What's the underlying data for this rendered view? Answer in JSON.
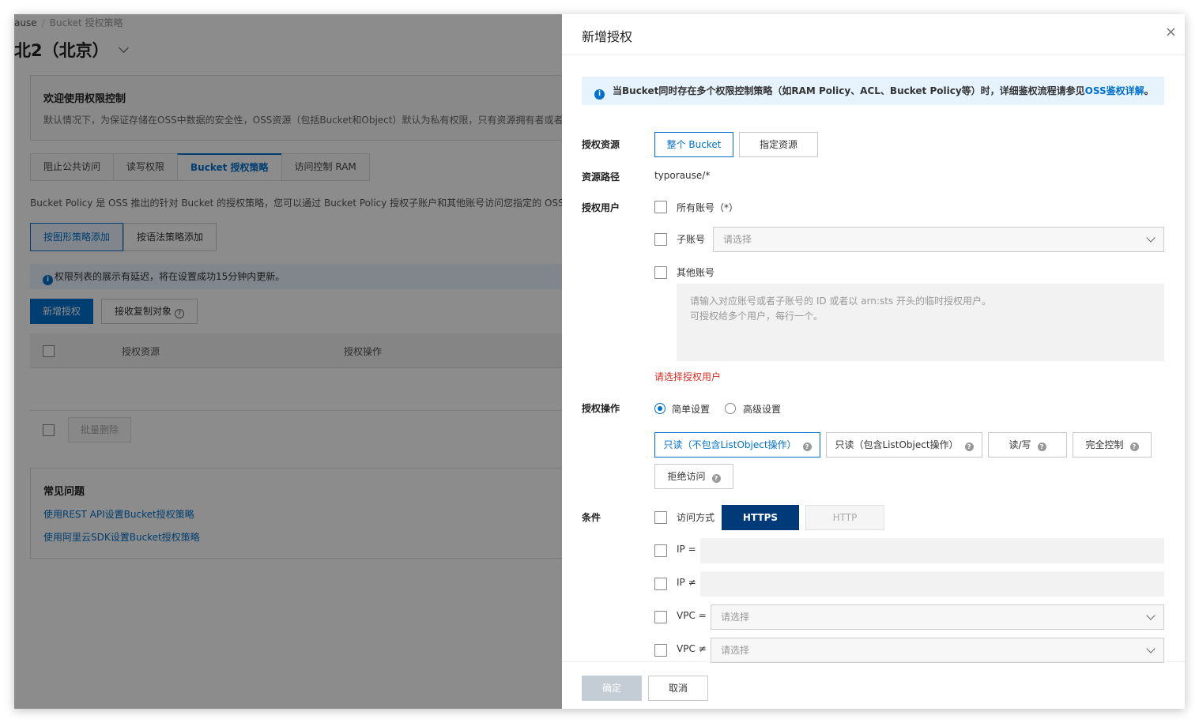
{
  "background": {
    "breadcrumb": {
      "first": "ause",
      "sep": "/",
      "current": "Bucket 授权策略"
    },
    "title": "北2（北京）",
    "welcome": {
      "heading": "欢迎使用权限控制",
      "text": "默认情况下，为保证存储在OSS中数据的安全性，OSS资源（包括Bucket和Object）默认为私有权限，只有资源拥有者或者被"
    },
    "tabs": [
      "阻止公共访问",
      "读写权限",
      "Bucket 授权策略",
      "访问控制 RAM"
    ],
    "active_tab": "Bucket 授权策略",
    "description": "Bucket Policy 是 OSS 推出的针对 Bucket 的授权策略，您可以通过 Bucket Policy 授权子账户和其他账号访问您指定的 OSS 资",
    "mode_buttons": [
      "按图形策略添加",
      "按语法策略添加"
    ],
    "notice": "权限列表的展示有延迟，将在设置成功15分钟内更新。",
    "actions": {
      "add": "新增授权",
      "receive": "接收复制对象"
    },
    "table_headers": [
      "授权资源",
      "授权操作"
    ],
    "bulk_delete": "批量删除",
    "faq": {
      "heading": "常见问题",
      "links": [
        "使用REST API设置Bucket授权策略",
        "使用阿里云SDK设置Bucket授权策略"
      ]
    }
  },
  "drawer": {
    "title": "新增授权",
    "close": "×",
    "alert": {
      "text": "当Bucket同时存在多个权限控制策略（如RAM Policy、ACL、Bucket Policy等）时，详细鉴权流程请参见",
      "link": "OSS鉴权详解",
      "end": "。"
    },
    "resource": {
      "label": "授权资源",
      "options": [
        "整个 Bucket",
        "指定资源"
      ],
      "selected": "整个 Bucket"
    },
    "path": {
      "label": "资源路径",
      "value": "typorause/*"
    },
    "users": {
      "label": "授权用户",
      "all_accounts": "所有账号（*）",
      "sub_account": "子账号",
      "sub_placeholder": "请选择",
      "other_account": "其他账号",
      "other_placeholder_line1": "请输入对应账号或者子账号的 ID 或者以 arn:sts 开头的临时授权用户。",
      "other_placeholder_line2": "可授权给多个用户，每行一个。",
      "error": "请选择授权用户"
    },
    "operation": {
      "label": "授权操作",
      "modes": [
        "简单设置",
        "高级设置"
      ],
      "selected_mode": "简单设置",
      "permissions": [
        "只读（不包含ListObject操作）",
        "只读（包含ListObject操作）",
        "读/写",
        "完全控制",
        "拒绝访问"
      ],
      "selected_permission": "只读（不包含ListObject操作）"
    },
    "conditions": {
      "label": "条件",
      "access_method": "访问方式",
      "protocols": [
        "HTTPS",
        "HTTP"
      ],
      "selected_protocol": "HTTPS",
      "ip_eq": "IP =",
      "ip_ne": "IP ≠",
      "vpc_eq": "VPC =",
      "vpc_ne": "VPC ≠",
      "vpc_placeholder": "请选择"
    },
    "footer": {
      "ok": "确定",
      "cancel": "取消"
    }
  }
}
